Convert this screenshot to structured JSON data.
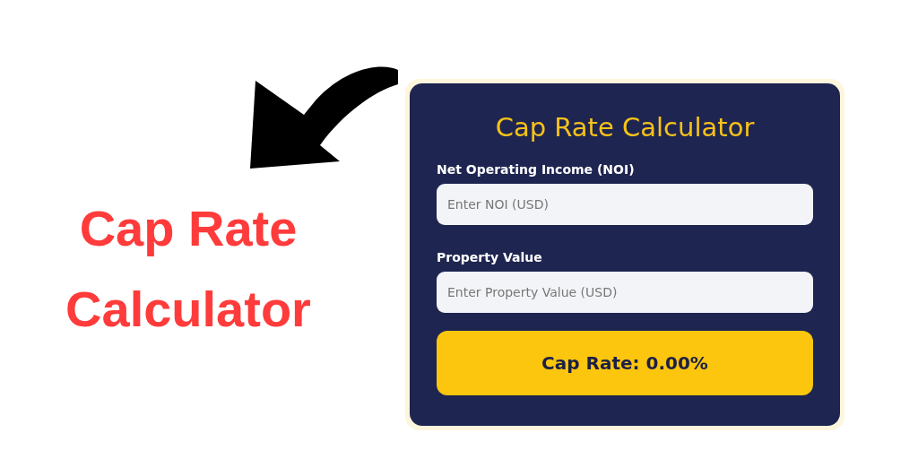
{
  "headline": [
    "Cap Rate",
    "Calculator"
  ],
  "calculator": {
    "title": "Cap Rate Calculator",
    "fields": [
      {
        "label": "Net Operating Income (NOI)",
        "placeholder": "Enter NOI (USD)"
      },
      {
        "label": "Property Value",
        "placeholder": "Enter Property Value (USD)"
      }
    ],
    "result": "Cap Rate: 0.00%"
  }
}
